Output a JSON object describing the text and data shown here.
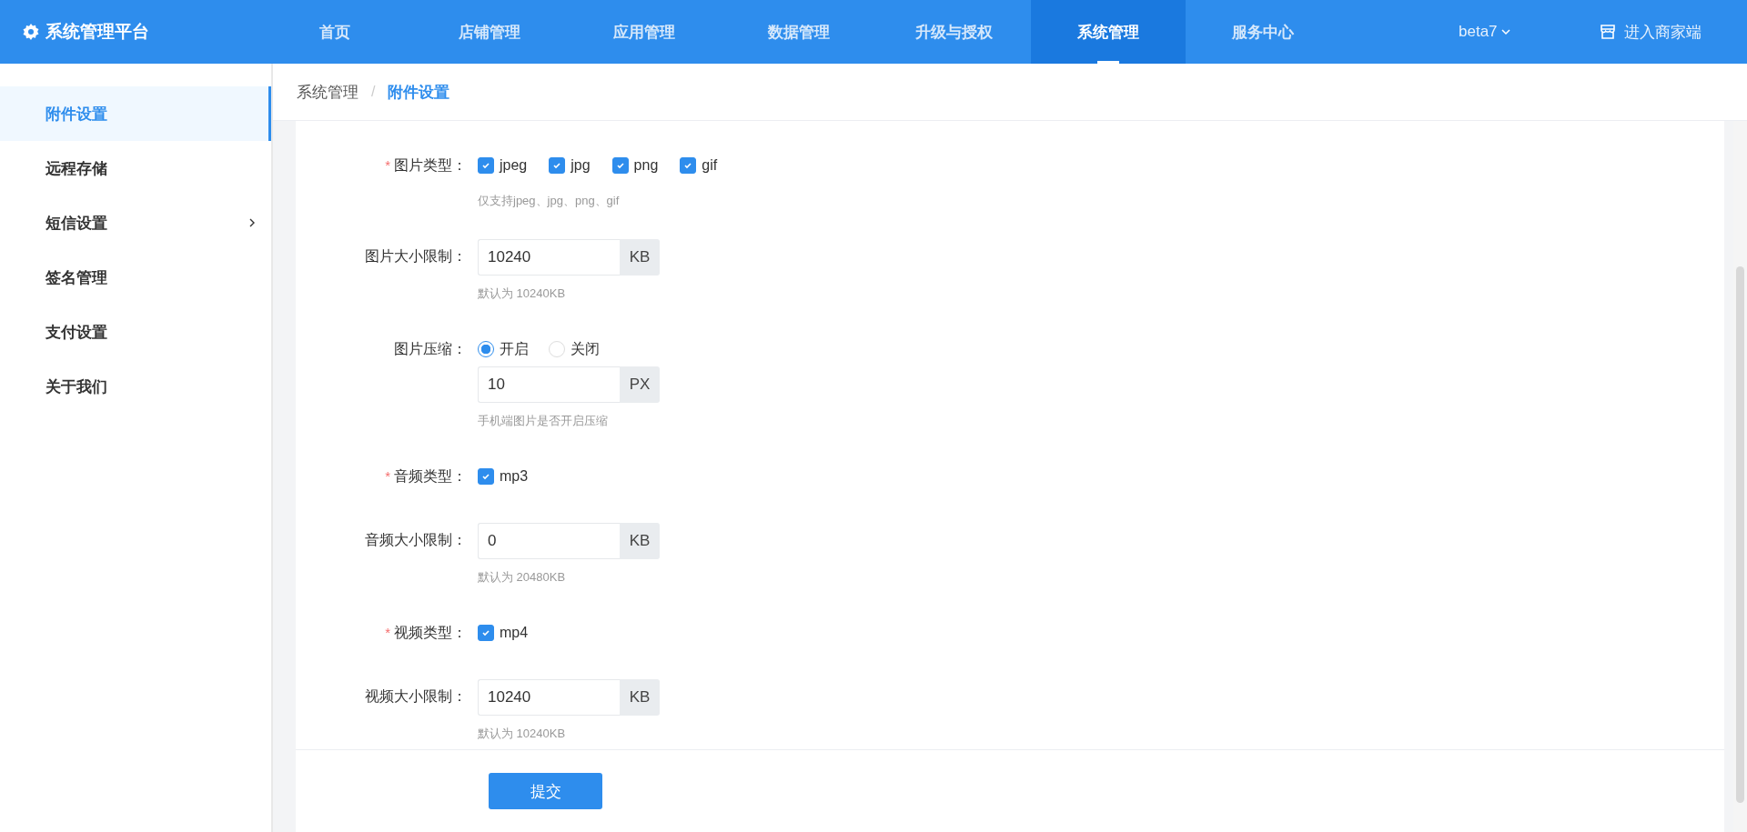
{
  "header": {
    "title": "系统管理平台",
    "nav": [
      {
        "label": "首页",
        "selected": false
      },
      {
        "label": "店铺管理",
        "selected": false
      },
      {
        "label": "应用管理",
        "selected": false
      },
      {
        "label": "数据管理",
        "selected": false
      },
      {
        "label": "升级与授权",
        "selected": false
      },
      {
        "label": "系统管理",
        "selected": true
      },
      {
        "label": "服务中心",
        "selected": false
      }
    ],
    "version": "beta7",
    "merchant_link": "进入商家端"
  },
  "sidebar": {
    "items": [
      {
        "label": "附件设置",
        "selected": true,
        "expandable": false
      },
      {
        "label": "远程存储",
        "selected": false,
        "expandable": false
      },
      {
        "label": "短信设置",
        "selected": false,
        "expandable": true
      },
      {
        "label": "签名管理",
        "selected": false,
        "expandable": false
      },
      {
        "label": "支付设置",
        "selected": false,
        "expandable": false
      },
      {
        "label": "关于我们",
        "selected": false,
        "expandable": false
      }
    ]
  },
  "breadcrumb": [
    {
      "label": "系统管理",
      "selected": false
    },
    {
      "label": "附件设置",
      "selected": true
    }
  ],
  "breadcrumb_separator": "/",
  "form": [
    {
      "kind": "checkboxes",
      "label": "图片类型：",
      "required": true,
      "options": [
        {
          "label": "jpeg",
          "checked": true
        },
        {
          "label": "jpg",
          "checked": true
        },
        {
          "label": "png",
          "checked": true
        },
        {
          "label": "gif",
          "checked": true
        }
      ],
      "hint": "仅支持jpeg、jpg、png、gif"
    },
    {
      "kind": "input",
      "label": "图片大小限制：",
      "required": false,
      "value": "10240",
      "unit": "KB",
      "hint": "默认为 10240KB"
    },
    {
      "kind": "radio_input",
      "label": "图片压缩：",
      "required": false,
      "options": [
        {
          "label": "开启",
          "selected": true
        },
        {
          "label": "关闭",
          "selected": false
        }
      ],
      "value": "10",
      "unit": "PX",
      "hint": "手机端图片是否开启压缩"
    },
    {
      "kind": "checkboxes",
      "label": "音频类型：",
      "required": true,
      "options": [
        {
          "label": "mp3",
          "checked": true
        }
      ]
    },
    {
      "kind": "input",
      "label": "音频大小限制：",
      "required": false,
      "value": "0",
      "unit": "KB",
      "hint": "默认为 20480KB"
    },
    {
      "kind": "checkboxes",
      "label": "视频类型：",
      "required": true,
      "options": [
        {
          "label": "mp4",
          "checked": true
        }
      ]
    },
    {
      "kind": "input",
      "label": "视频大小限制：",
      "required": false,
      "value": "10240",
      "unit": "KB",
      "hint": "默认为 10240KB"
    }
  ],
  "required_mark": "*",
  "submit": "提交"
}
